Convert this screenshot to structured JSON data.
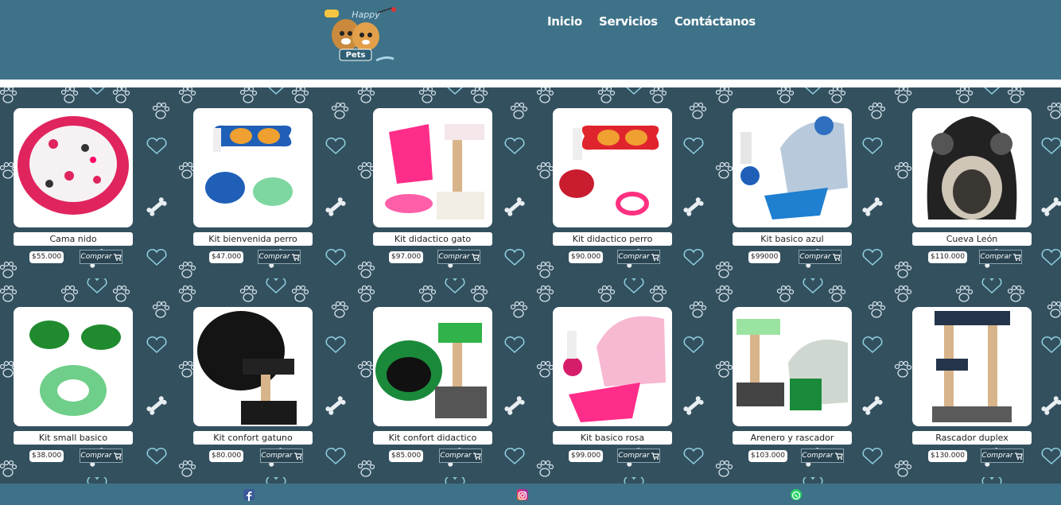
{
  "header": {
    "logo_text_top": "Happy",
    "logo_text_bottom": "Pets",
    "nav": [
      {
        "label": "Inicio"
      },
      {
        "label": "Servicios"
      },
      {
        "label": "Contáctanos"
      }
    ]
  },
  "buy_label": "Comprar",
  "products": [
    {
      "name": "Cama nido",
      "price": "$55.000",
      "icon": "pet-bed-image"
    },
    {
      "name": "Kit bienvenida perro",
      "price": "$47.000",
      "icon": "dog-bowls-image"
    },
    {
      "name": "Kit didactico gato",
      "price": "$97.000",
      "icon": "cat-scratcher-image"
    },
    {
      "name": "Kit didactico perro",
      "price": "$90.000",
      "icon": "dog-feeder-image"
    },
    {
      "name": "Kit basico azul",
      "price": "$99000",
      "icon": "blue-litter-box-image"
    },
    {
      "name": "Cueva León",
      "price": "$110.000",
      "icon": "cave-bed-image"
    },
    {
      "name": "Kit small basico",
      "price": "$38.000",
      "icon": "green-bowls-image"
    },
    {
      "name": "Kit confort gatuno",
      "price": "$80.000",
      "icon": "cat-bed-image"
    },
    {
      "name": "Kit confort didactico",
      "price": "$85.000",
      "icon": "green-bed-image"
    },
    {
      "name": "Kit basico rosa",
      "price": "$99.000",
      "icon": "pink-litter-box-image"
    },
    {
      "name": "Arenero y rascador",
      "price": "$103.000",
      "icon": "litter-scratcher-image"
    },
    {
      "name": "Rascador duplex",
      "price": "$130.000",
      "icon": "duplex-scratcher-image"
    }
  ],
  "footer": [
    {
      "icon": "facebook-icon",
      "color": "#3b5998"
    },
    {
      "icon": "instagram-icon",
      "color": "#e1306c"
    },
    {
      "icon": "whatsapp-icon",
      "color": "#25d366"
    }
  ]
}
